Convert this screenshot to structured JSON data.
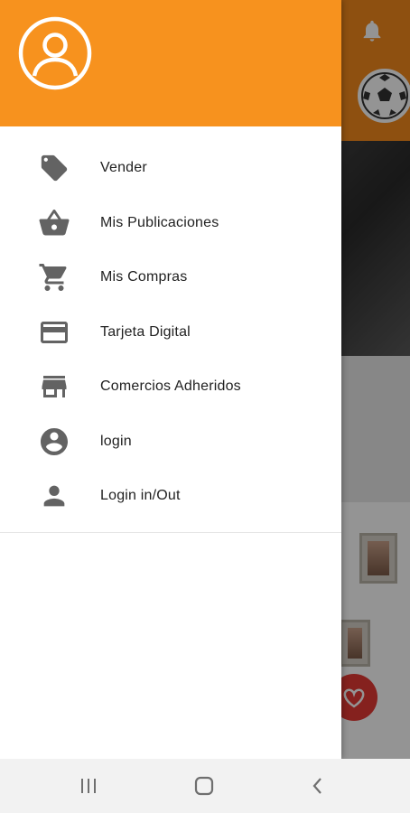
{
  "drawer": {
    "header_color": "#f7921e",
    "avatar_icon": "account-circle-icon",
    "items": [
      {
        "label": "Vender",
        "icon": "tag-icon"
      },
      {
        "label": "Mis Publicaciones",
        "icon": "basket-icon"
      },
      {
        "label": "Mis Compras",
        "icon": "cart-icon"
      },
      {
        "label": "Tarjeta Digital",
        "icon": "credit-card-icon"
      },
      {
        "label": "Comercios Adheridos",
        "icon": "store-icon"
      },
      {
        "label": "login",
        "icon": "account-circle-icon"
      },
      {
        "label": "Login in/Out",
        "icon": "person-icon"
      }
    ]
  },
  "background": {
    "accent": "#f58b1c",
    "notification_icon": "bell-icon",
    "category_icon": "soccer-ball-icon",
    "favorite_icon": "heart-icon"
  },
  "system_nav": {
    "recents_icon": "recents-icon",
    "home_icon": "home-icon",
    "back_icon": "back-icon"
  }
}
